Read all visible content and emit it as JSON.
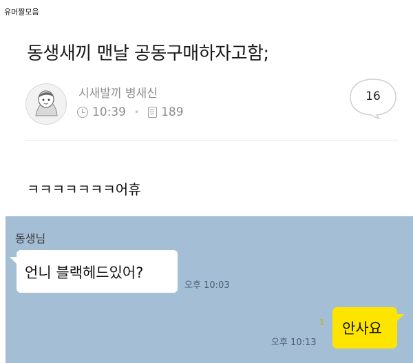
{
  "site_label": "유머짤모음",
  "post": {
    "title": "동생새끼 맨날 공동구매하자고함;",
    "author": "시새발끼 병새신",
    "time": "10:39",
    "views": "189",
    "comment_count": "16",
    "body": "ㅋㅋㅋㅋㅋㅋㅋ어휴"
  },
  "chat": {
    "sender": "동생님",
    "incoming": {
      "text": "언니 블랙헤드있어?",
      "time": "오후 10:03"
    },
    "outgoing": {
      "text": "안사요",
      "time": "오후 10:13",
      "unread": "1"
    },
    "colors": {
      "background": "#a4bed6",
      "incoming_bubble": "#ffffff",
      "outgoing_bubble": "#fee500"
    }
  },
  "icons": {
    "clock": "clock-icon",
    "views": "document-icon",
    "comments": "speech-bubble-icon",
    "avatar": "character-avatar"
  }
}
